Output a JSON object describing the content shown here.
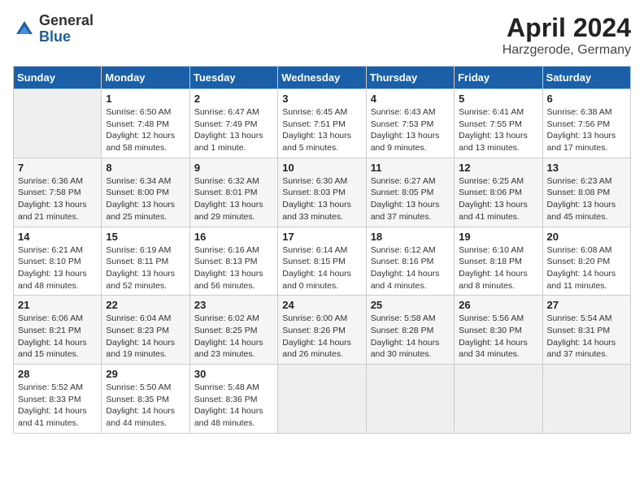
{
  "logo": {
    "general": "General",
    "blue": "Blue"
  },
  "header": {
    "month": "April 2024",
    "location": "Harzgerode, Germany"
  },
  "weekdays": [
    "Sunday",
    "Monday",
    "Tuesday",
    "Wednesday",
    "Thursday",
    "Friday",
    "Saturday"
  ],
  "weeks": [
    [
      null,
      {
        "day": "1",
        "sunrise": "6:50 AM",
        "sunset": "7:48 PM",
        "daylight": "12 hours and 58 minutes."
      },
      {
        "day": "2",
        "sunrise": "6:47 AM",
        "sunset": "7:49 PM",
        "daylight": "13 hours and 1 minute."
      },
      {
        "day": "3",
        "sunrise": "6:45 AM",
        "sunset": "7:51 PM",
        "daylight": "13 hours and 5 minutes."
      },
      {
        "day": "4",
        "sunrise": "6:43 AM",
        "sunset": "7:53 PM",
        "daylight": "13 hours and 9 minutes."
      },
      {
        "day": "5",
        "sunrise": "6:41 AM",
        "sunset": "7:55 PM",
        "daylight": "13 hours and 13 minutes."
      },
      {
        "day": "6",
        "sunrise": "6:38 AM",
        "sunset": "7:56 PM",
        "daylight": "13 hours and 17 minutes."
      }
    ],
    [
      {
        "day": "7",
        "sunrise": "6:36 AM",
        "sunset": "7:58 PM",
        "daylight": "13 hours and 21 minutes."
      },
      {
        "day": "8",
        "sunrise": "6:34 AM",
        "sunset": "8:00 PM",
        "daylight": "13 hours and 25 minutes."
      },
      {
        "day": "9",
        "sunrise": "6:32 AM",
        "sunset": "8:01 PM",
        "daylight": "13 hours and 29 minutes."
      },
      {
        "day": "10",
        "sunrise": "6:30 AM",
        "sunset": "8:03 PM",
        "daylight": "13 hours and 33 minutes."
      },
      {
        "day": "11",
        "sunrise": "6:27 AM",
        "sunset": "8:05 PM",
        "daylight": "13 hours and 37 minutes."
      },
      {
        "day": "12",
        "sunrise": "6:25 AM",
        "sunset": "8:06 PM",
        "daylight": "13 hours and 41 minutes."
      },
      {
        "day": "13",
        "sunrise": "6:23 AM",
        "sunset": "8:08 PM",
        "daylight": "13 hours and 45 minutes."
      }
    ],
    [
      {
        "day": "14",
        "sunrise": "6:21 AM",
        "sunset": "8:10 PM",
        "daylight": "13 hours and 48 minutes."
      },
      {
        "day": "15",
        "sunrise": "6:19 AM",
        "sunset": "8:11 PM",
        "daylight": "13 hours and 52 minutes."
      },
      {
        "day": "16",
        "sunrise": "6:16 AM",
        "sunset": "8:13 PM",
        "daylight": "13 hours and 56 minutes."
      },
      {
        "day": "17",
        "sunrise": "6:14 AM",
        "sunset": "8:15 PM",
        "daylight": "14 hours and 0 minutes."
      },
      {
        "day": "18",
        "sunrise": "6:12 AM",
        "sunset": "8:16 PM",
        "daylight": "14 hours and 4 minutes."
      },
      {
        "day": "19",
        "sunrise": "6:10 AM",
        "sunset": "8:18 PM",
        "daylight": "14 hours and 8 minutes."
      },
      {
        "day": "20",
        "sunrise": "6:08 AM",
        "sunset": "8:20 PM",
        "daylight": "14 hours and 11 minutes."
      }
    ],
    [
      {
        "day": "21",
        "sunrise": "6:06 AM",
        "sunset": "8:21 PM",
        "daylight": "14 hours and 15 minutes."
      },
      {
        "day": "22",
        "sunrise": "6:04 AM",
        "sunset": "8:23 PM",
        "daylight": "14 hours and 19 minutes."
      },
      {
        "day": "23",
        "sunrise": "6:02 AM",
        "sunset": "8:25 PM",
        "daylight": "14 hours and 23 minutes."
      },
      {
        "day": "24",
        "sunrise": "6:00 AM",
        "sunset": "8:26 PM",
        "daylight": "14 hours and 26 minutes."
      },
      {
        "day": "25",
        "sunrise": "5:58 AM",
        "sunset": "8:28 PM",
        "daylight": "14 hours and 30 minutes."
      },
      {
        "day": "26",
        "sunrise": "5:56 AM",
        "sunset": "8:30 PM",
        "daylight": "14 hours and 34 minutes."
      },
      {
        "day": "27",
        "sunrise": "5:54 AM",
        "sunset": "8:31 PM",
        "daylight": "14 hours and 37 minutes."
      }
    ],
    [
      {
        "day": "28",
        "sunrise": "5:52 AM",
        "sunset": "8:33 PM",
        "daylight": "14 hours and 41 minutes."
      },
      {
        "day": "29",
        "sunrise": "5:50 AM",
        "sunset": "8:35 PM",
        "daylight": "14 hours and 44 minutes."
      },
      {
        "day": "30",
        "sunrise": "5:48 AM",
        "sunset": "8:36 PM",
        "daylight": "14 hours and 48 minutes."
      },
      null,
      null,
      null,
      null
    ]
  ],
  "labels": {
    "sunrise": "Sunrise:",
    "sunset": "Sunset:",
    "daylight": "Daylight:"
  }
}
